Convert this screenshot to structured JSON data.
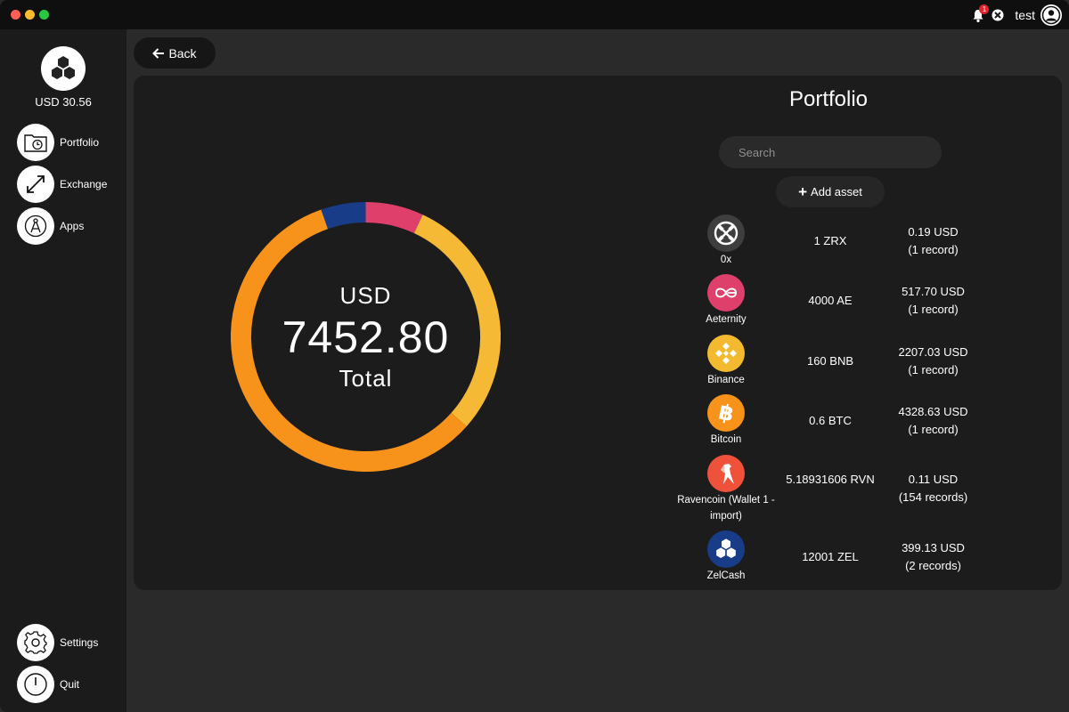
{
  "titlebar": {
    "notification_count": "1",
    "user": "test"
  },
  "sidebar": {
    "balance": "USD 30.56",
    "nav": [
      {
        "label": "Portfolio",
        "icon": "portfolio-icon"
      },
      {
        "label": "Exchange",
        "icon": "exchange-icon"
      },
      {
        "label": "Apps",
        "icon": "apps-icon"
      }
    ],
    "bottom": [
      {
        "label": "Settings",
        "icon": "gear-icon"
      },
      {
        "label": "Quit",
        "icon": "power-icon"
      }
    ]
  },
  "back_label": "Back",
  "summary": {
    "currency": "USD",
    "total_value": "7452.80",
    "total_label": "Total"
  },
  "portfolio": {
    "title": "Portfolio",
    "search_placeholder": "Search",
    "add_asset_label": "Add asset",
    "assets": [
      {
        "name": "0x",
        "amount": "1 ZRX",
        "value": "0.19 USD",
        "records": "(1 record)",
        "color": "#3e3e3e",
        "icon": "zrx-icon"
      },
      {
        "name": "Aeternity",
        "amount": "4000 AE",
        "value": "517.70 USD",
        "records": "(1 record)",
        "color": "#de3f6b",
        "icon": "aeternity-icon"
      },
      {
        "name": "Binance",
        "amount": "160 BNB",
        "value": "2207.03 USD",
        "records": "(1 record)",
        "color": "#f3ba2f",
        "icon": "binance-icon"
      },
      {
        "name": "Bitcoin",
        "amount": "0.6 BTC",
        "value": "4328.63 USD",
        "records": "(1 record)",
        "color": "#f7931a",
        "icon": "bitcoin-icon"
      },
      {
        "name": "Ravencoin (Wallet 1 - import)",
        "amount": "5.18931606 RVN",
        "value": "0.11 USD",
        "records": "(154 records)",
        "color": "#f0513a",
        "icon": "ravencoin-icon"
      },
      {
        "name": "ZelCash",
        "amount": "12001 ZEL",
        "value": "399.13 USD",
        "records": "(2 records)",
        "color": "#183c87",
        "icon": "zelcash-icon"
      }
    ]
  },
  "chart_data": {
    "type": "pie",
    "categories": [
      "ZRX",
      "AE",
      "BNB",
      "BTC",
      "RVN",
      "ZEL"
    ],
    "values": [
      0.19,
      517.7,
      2207.03,
      4328.63,
      0.11,
      399.13
    ],
    "colors": [
      "#3e3e3e",
      "#de3f6b",
      "#f5b935",
      "#f7931a",
      "#f0513a",
      "#183c87"
    ]
  }
}
